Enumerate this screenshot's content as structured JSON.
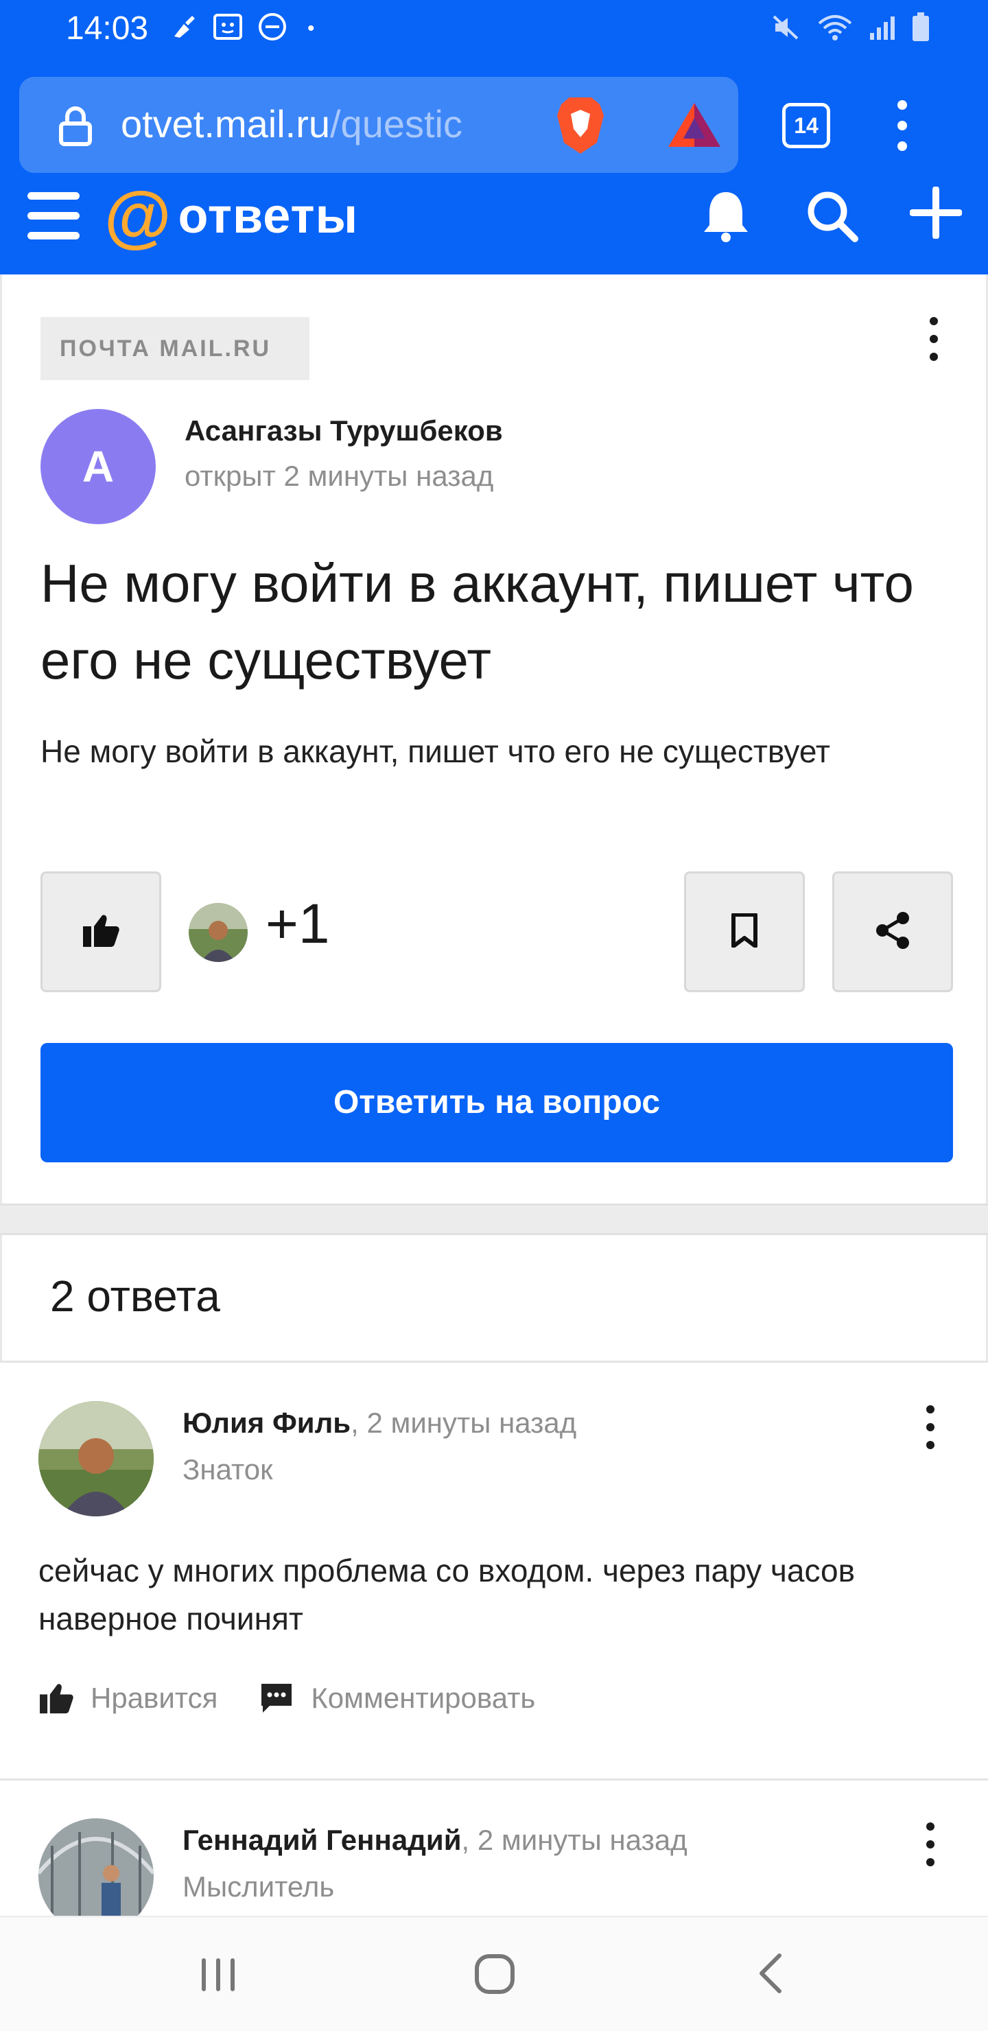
{
  "status_bar": {
    "time": "14:03",
    "dot": "•"
  },
  "browser": {
    "url_domain": "otvet.mail.ru",
    "url_path": "/questic",
    "tab_count": "14"
  },
  "site": {
    "logo_text": "ответы",
    "logo_symbol": "@"
  },
  "question": {
    "category": "ПОЧТА MAIL.RU",
    "avatar_letter": "A",
    "author": "Асангазы Турушбеков",
    "time": "открыт 2 минуты назад",
    "title": "Не могу войти в аккаунт, пишет что его не существует",
    "body": "Не могу войти в аккаунт, пишет что его не существует",
    "like_count": "+1",
    "answer_button": "Ответить на вопрос"
  },
  "answers_header": "2 ответа",
  "answers": [
    {
      "name": "Юлия Филь",
      "time": ", 2 минуты назад",
      "rank": "Знаток",
      "text": "сейчас у многих проблема со входом. через пару часов наверное починят",
      "like_label": "Нравится",
      "comment_label": "Комментировать"
    },
    {
      "name": "Геннадий Геннадий",
      "time": ", 2 минуты назад",
      "rank": "Мыслитель"
    }
  ],
  "colors": {
    "brand_blue": "#0863f7",
    "logo_orange": "#ffa930",
    "avatar_purple": "#8a7cf0"
  }
}
